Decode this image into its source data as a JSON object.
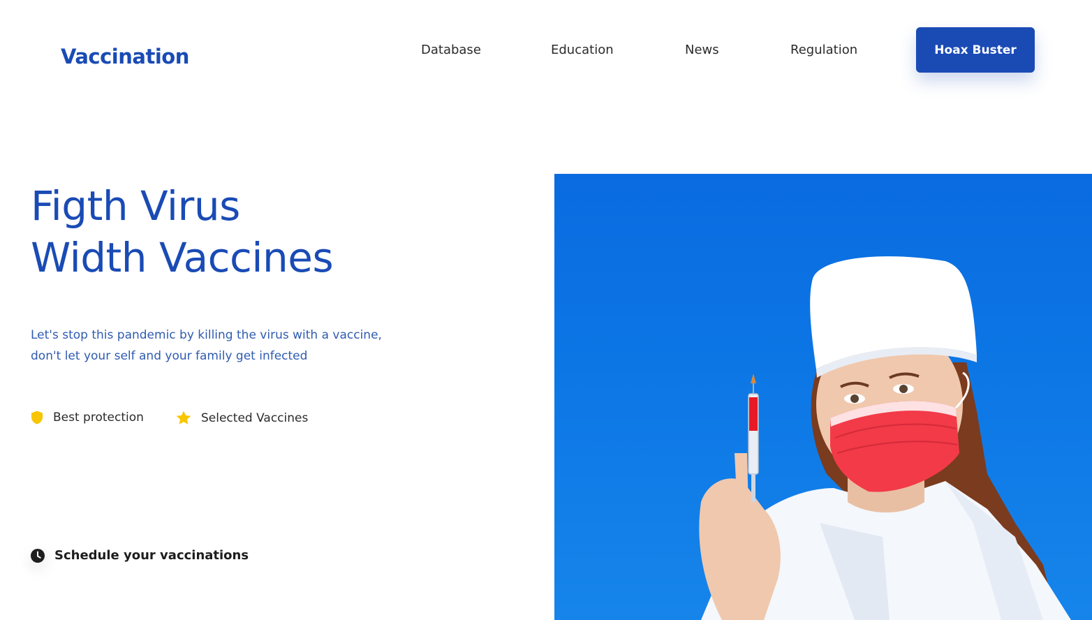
{
  "header": {
    "logo": "Vaccination",
    "nav": [
      "Database",
      "Education",
      "News",
      "Regulation"
    ],
    "cta_label": "Hoax Buster"
  },
  "hero": {
    "title_lines": [
      "Figth Virus",
      "Width Vaccines"
    ],
    "description_lines": [
      "Let's stop this pandemic by killing the virus with a vaccine,",
      "don't let your self and your family get infected"
    ],
    "features": [
      {
        "icon": "shield-icon",
        "label": "Best protection"
      },
      {
        "icon": "star-icon",
        "label": "Selected Vaccines"
      }
    ],
    "schedule_label": "Schedule your vaccinations",
    "image_alt": "nurse-with-syringe-photo"
  },
  "colors": {
    "brand_blue": "#1a4bb5",
    "feature_yellow": "#f7c600",
    "photo_blue": "#0a6be0",
    "mask_red": "#f23a48"
  }
}
